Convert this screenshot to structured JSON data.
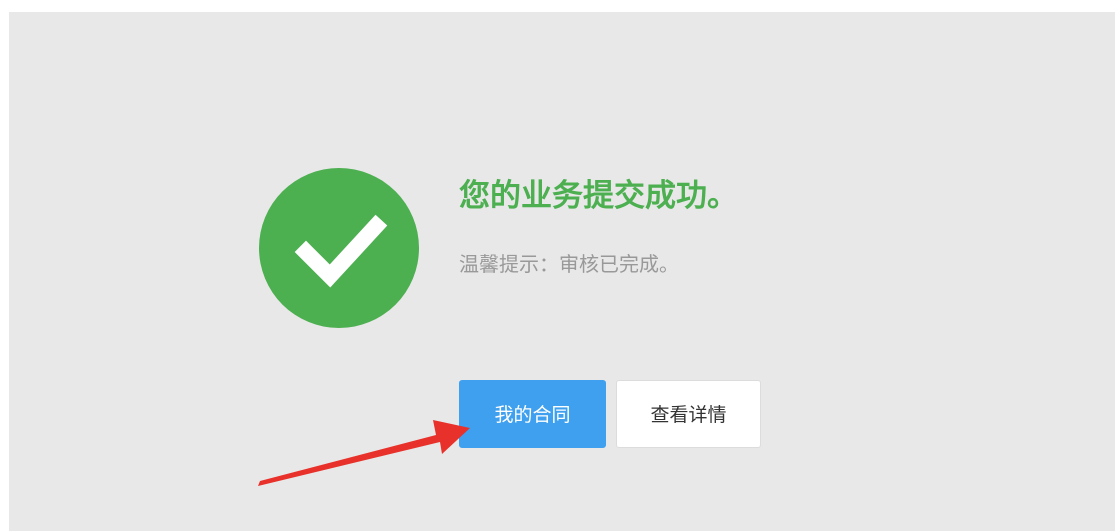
{
  "result": {
    "title": "您的业务提交成功。",
    "hint": "温馨提示：审核已完成。",
    "icon": "checkmark-circle-icon",
    "accent_color": "#4caf50"
  },
  "actions": {
    "primary_label": "我的合同",
    "secondary_label": "查看详情",
    "primary_color": "#3fa0f0"
  },
  "annotation": {
    "icon": "red-arrow-annotation",
    "color": "#e8312a"
  }
}
